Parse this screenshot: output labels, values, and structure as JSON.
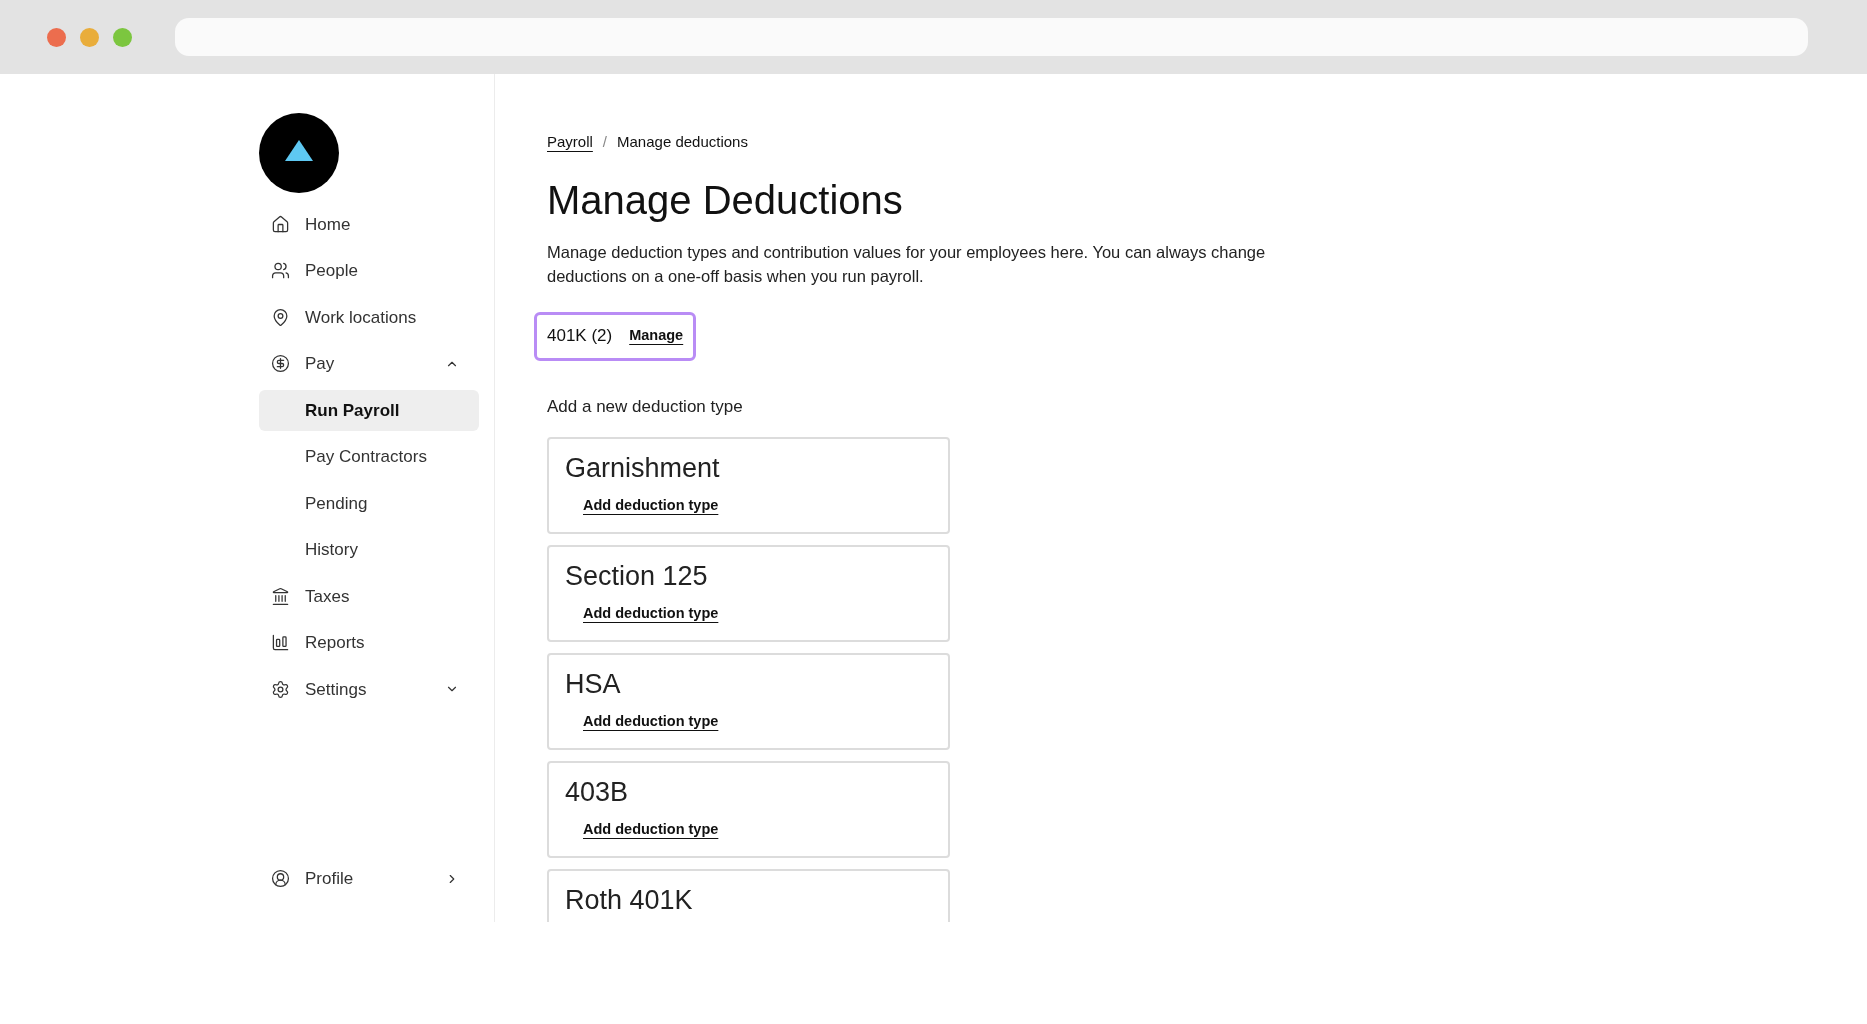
{
  "sidebar": {
    "items": [
      {
        "label": "Home",
        "selected": false
      },
      {
        "label": "People",
        "selected": false
      },
      {
        "label": "Work locations",
        "selected": false
      },
      {
        "label": "Pay",
        "selected": false,
        "expanded": true,
        "children": [
          {
            "label": "Run Payroll",
            "selected": true
          },
          {
            "label": "Pay Contractors",
            "selected": false
          },
          {
            "label": "Pending",
            "selected": false
          },
          {
            "label": "History",
            "selected": false
          }
        ]
      },
      {
        "label": "Taxes",
        "selected": false
      },
      {
        "label": "Reports",
        "selected": false
      },
      {
        "label": "Settings",
        "selected": false,
        "expanded": false
      }
    ],
    "profile": {
      "label": "Profile"
    }
  },
  "breadcrumb": {
    "items": [
      "Payroll",
      "Manage deductions"
    ],
    "separator": "/"
  },
  "title": "Manage Deductions",
  "description": "Manage deduction types and contribution values for your employees here. You can always change deductions on a one-off basis when you run payroll.",
  "existing": [
    {
      "label": "401K (2)",
      "action": "Manage"
    }
  ],
  "new_section": {
    "heading": "Add a new deduction type",
    "cards": [
      {
        "title": "Garnishment",
        "action": "Add deduction type"
      },
      {
        "title": "Section 125",
        "action": "Add deduction type"
      },
      {
        "title": "HSA",
        "action": "Add deduction type"
      },
      {
        "title": "403B",
        "action": "Add deduction type"
      },
      {
        "title": "Roth 401K"
      }
    ]
  }
}
